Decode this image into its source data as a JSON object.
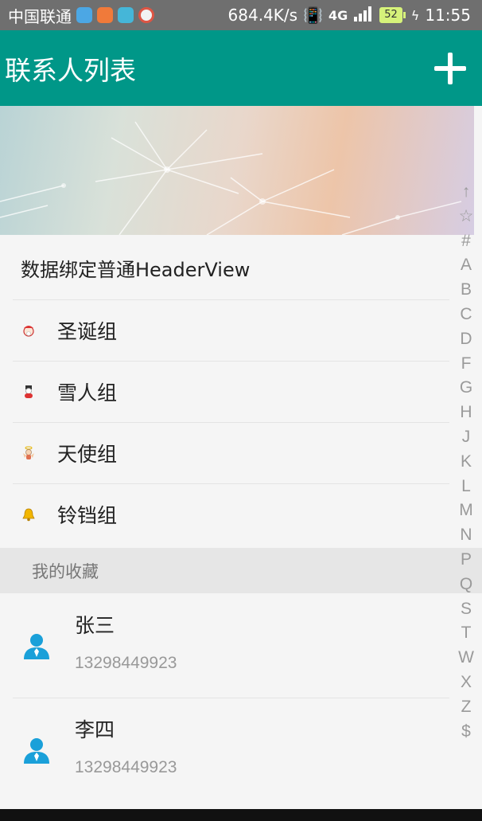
{
  "status_bar": {
    "carrier": "中国联通",
    "speed": "684.4K/s",
    "network": "4G",
    "battery": "52",
    "time": "11:55"
  },
  "app_bar": {
    "title": "联系人列表",
    "add_icon": "plus-icon"
  },
  "header_view": {
    "label": "数据绑定普通HeaderView"
  },
  "groups": [
    {
      "label": "圣诞组",
      "icon": "santa-icon"
    },
    {
      "label": "雪人组",
      "icon": "snowman-icon"
    },
    {
      "label": "天使组",
      "icon": "angel-icon"
    },
    {
      "label": "铃铛组",
      "icon": "bell-icon"
    }
  ],
  "favorites_section": {
    "title": "我的收藏"
  },
  "contacts": [
    {
      "name": "张三",
      "phone": "13298449923"
    },
    {
      "name": "李四",
      "phone": "13298449923"
    }
  ],
  "side_index": [
    "↑",
    "☆",
    "#",
    "A",
    "B",
    "C",
    "D",
    "F",
    "G",
    "H",
    "J",
    "K",
    "L",
    "M",
    "N",
    "P",
    "Q",
    "S",
    "T",
    "W",
    "X",
    "Z",
    "$"
  ],
  "colors": {
    "primary": "#009788",
    "status_bar": "#6f6f6f",
    "avatar": "#1aa0d9"
  }
}
